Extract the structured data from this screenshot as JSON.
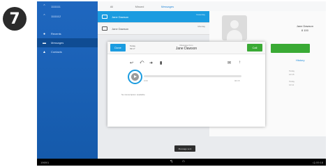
{
  "step_number": "7",
  "sidebar": {
    "header_items": [
      {
        "icon": "chevron-up-icon",
        "label": "1111111"
      },
      {
        "icon": "chevron-up-icon",
        "label": "1111112"
      }
    ],
    "items": [
      {
        "icon": "user-icon",
        "label": "Recents"
      },
      {
        "icon": "envelope-icon",
        "label": "Messages"
      },
      {
        "icon": "contact-card-icon",
        "label": "Contacts"
      }
    ],
    "active_index": 1
  },
  "tabs": [
    "All",
    "Missed",
    "Messages"
  ],
  "tabs_active_index": 2,
  "list": [
    {
      "name": "Jane Dawson",
      "sub": "10:15",
      "meta": "Yesterday",
      "selected": true
    },
    {
      "name": "Jane Dawson",
      "sub": "",
      "meta": "Monday",
      "selected": false
    }
  ],
  "detail": {
    "name": "Jane Dawson",
    "number": "8 100",
    "call_label": "Call",
    "history_label": "History",
    "info_lines": [
      "Today",
      "10:15",
      "",
      "Today",
      "10:11"
    ]
  },
  "dialog": {
    "done_label": "Done",
    "today_label": "Today",
    "today_time": "09:17",
    "title_small": "Message from",
    "title_name": "Jane Dawson",
    "call_label": "Call",
    "time_start": "0:00",
    "time_end": "00:15",
    "progress_fraction": 0.0,
    "transcript": "No transcription available"
  },
  "tooltip": "Message sent",
  "bottom_bar": {
    "left": "1969/1",
    "right": "◁) 09:18"
  },
  "colors": {
    "accent": "#1b9ce0",
    "call_green": "#3aaa35",
    "sidebar_blue": "#1f67bf"
  }
}
